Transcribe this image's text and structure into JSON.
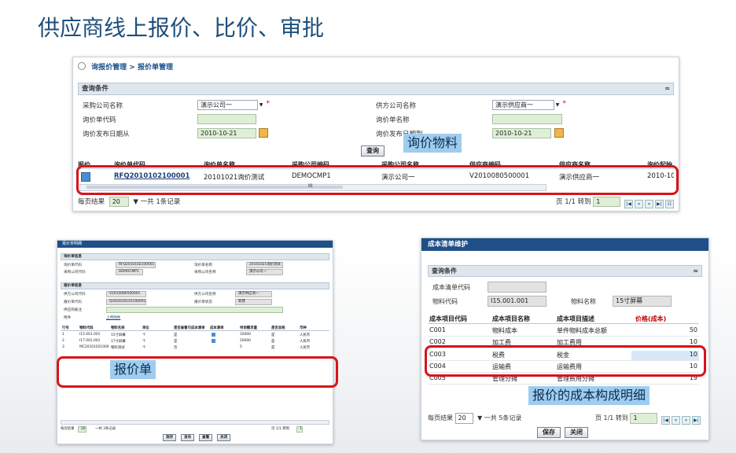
{
  "slide": {
    "title": "供应商线上报价、比价、审批"
  },
  "colors": {
    "accent": "#1e4f88",
    "highlight": "#d7141a",
    "callout": "#9ecdf0",
    "input": "#dfefd7"
  },
  "callouts": {
    "material": "询价物料",
    "quote_sheet": "报价单",
    "cost_detail": "报价的成本构成明细"
  },
  "rfq_list": {
    "breadcrumb": {
      "root": "询报价管理",
      "separator": ">",
      "current": "报价单管理"
    },
    "query_panel": {
      "title": "查询条件",
      "collapse": "≈"
    },
    "fields": {
      "purchaser_label": "采购公司名称",
      "purchaser_value": "演示公司一",
      "rfq_code_label": "询价单代码",
      "rfq_code_value": "",
      "publish_from_label": "询价发布日期从",
      "publish_from_value": "2010-10-21",
      "supplier_label": "供方公司名称",
      "supplier_value": "演示供应商一",
      "rfq_name_label": "询价单名称",
      "rfq_name_value": "",
      "publish_to_label": "询价发布日期到",
      "publish_to_value": "2010-10-21"
    },
    "query_button": "查询",
    "columns": [
      "报价",
      "询价单代码",
      "询价单名称",
      "采购公司编码",
      "采购公司名称",
      "供应商编码",
      "供应商名称",
      "询价起始"
    ],
    "rows": [
      {
        "code": "RFQ2010102100001",
        "name": "20101021询价测试",
        "buyer_code": "DEMOCMP1",
        "buyer_name": "演示公司一",
        "supplier_code": "V2010080500001",
        "supplier_name": "演示供应商一",
        "start": "2010-10"
      }
    ],
    "scroll_mark": "III",
    "pager": {
      "per_page_label": "每页结果",
      "per_page": "20",
      "total": "一共 1条记录",
      "page_info": "页 1/1 转到",
      "goto": "1"
    }
  },
  "quote_sheet": {
    "title": "报价单明细",
    "rfq_panel": "询价单信息",
    "rfq_code_label": "询价单代码",
    "rfq_code": "RFQ2010102100001",
    "rfq_name_label": "询价单名称",
    "rfq_name": "20101021询价测试",
    "buyer_code_label": "采购公司代码",
    "buyer_code": "DEMOCMP1",
    "buyer_name_label": "采购公司名称",
    "buyer_name": "演示公司一",
    "quote_panel": "报价单信息",
    "supplier_code_label": "供方公司代码",
    "supplier_code": "V2010080500001",
    "supplier_name_label": "供方公司名称",
    "supplier_name": "演示供应商一",
    "quote_code_label": "报价单代码",
    "quote_code": "QUO2010102100001",
    "status_label": "报价单状态",
    "status": "新建",
    "remark_label": "供应商备注",
    "remark": "",
    "attach_label": "附件",
    "attach_link": "上传附件",
    "columns": [
      "行号",
      "物料代码",
      "物料名称",
      "单位",
      "是否查看可成本清单",
      "成本清单",
      "待询需求量",
      "是否含税",
      "币种"
    ],
    "rows": [
      [
        "1",
        "I15.001.001",
        "15寸屏幕",
        "个",
        "是",
        "",
        "10000",
        "是",
        "人民币"
      ],
      [
        "2",
        "I17.001.001",
        "17寸屏幕",
        "个",
        "是",
        "",
        "20000",
        "是",
        "人民币"
      ],
      [
        "3",
        "MC20101021000",
        "物料测试",
        "个",
        "否",
        "",
        "5",
        "是",
        "人民币"
      ]
    ],
    "pager": {
      "per_page_label": "每页结果",
      "per_page": "20",
      "total": "一共 3条记录",
      "page_info": "页 1/1 转到",
      "goto": "1"
    },
    "buttons": {
      "save": "保存",
      "publish": "发布",
      "view": "查看",
      "close": "关闭"
    }
  },
  "cost_list": {
    "title": "成本清单维护",
    "query_panel": "查询条件",
    "collapse": "≈",
    "cost_code_label": "成本清单代码",
    "cost_code": "",
    "material_code_label": "物料代码",
    "material_code": "I15.001.001",
    "material_name_label": "物料名称",
    "material_name": "15寸屏幕",
    "columns": [
      "成本项目代码",
      "成本项目名称",
      "成本项目描述",
      "价格(成本)"
    ],
    "rows": [
      {
        "code": "C001",
        "name": "物料成本",
        "desc": "单件物料成本总额",
        "price": "50"
      },
      {
        "code": "C002",
        "name": "加工费",
        "desc": "加工费用",
        "price": "10"
      },
      {
        "code": "C003",
        "name": "税费",
        "desc": "税金",
        "price": "10"
      },
      {
        "code": "C004",
        "name": "运输费",
        "desc": "运输费用",
        "price": "10"
      },
      {
        "code": "C005",
        "name": "管理分摊",
        "desc": "管理费用分摊",
        "price": "19"
      }
    ],
    "pager": {
      "per_page_label": "每页结果",
      "per_page": "20",
      "total": "一共 5条记录",
      "page_info": "页 1/1 转到",
      "goto": "1"
    },
    "buttons": {
      "save": "保存",
      "close": "关闭"
    }
  }
}
